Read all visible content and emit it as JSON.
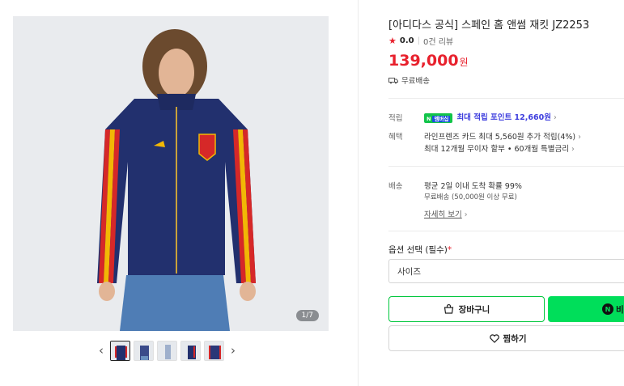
{
  "gallery": {
    "counter_current": "1",
    "counter_total": "/7",
    "prev_arrow": "‹",
    "next_arrow": "›"
  },
  "product": {
    "title": "[아디다스 공식] 스페인 홈 앤썸 재킷 JZ2253",
    "rating": "0.0",
    "reviews": "0건 리뷰",
    "price": "139,000",
    "currency": "원",
    "shipping": "무료배송"
  },
  "benefits": {
    "points_label": "적립",
    "npay_badge": "N",
    "npay_badge_sub": "멤버십",
    "points_text": "최대 적립 포인트 12,660원",
    "perks_label": "혜택",
    "perk1": "라인프렌즈 카드 최대 5,560원 추가 적립(4%)",
    "perk2": "최대 12개월 무이자 할부 • 60개월 특별금리"
  },
  "delivery": {
    "label": "배송",
    "line1": "평균 2일 이내 도착 확률 99%",
    "line2": "무료배송 (50,000원 이상 무료)",
    "details_link": "자세히 보기"
  },
  "options": {
    "title": "옵션 선택 (필수)",
    "required_mark": "*",
    "size_placeholder": "사이즈"
  },
  "actions": {
    "cart": "장바구니",
    "buy": "비",
    "buy_icon": "N",
    "wish": "찜하기"
  },
  "colors": {
    "accent_red": "#e8212d",
    "naver_green": "#00de5a",
    "point_blue": "#3e3ede"
  }
}
